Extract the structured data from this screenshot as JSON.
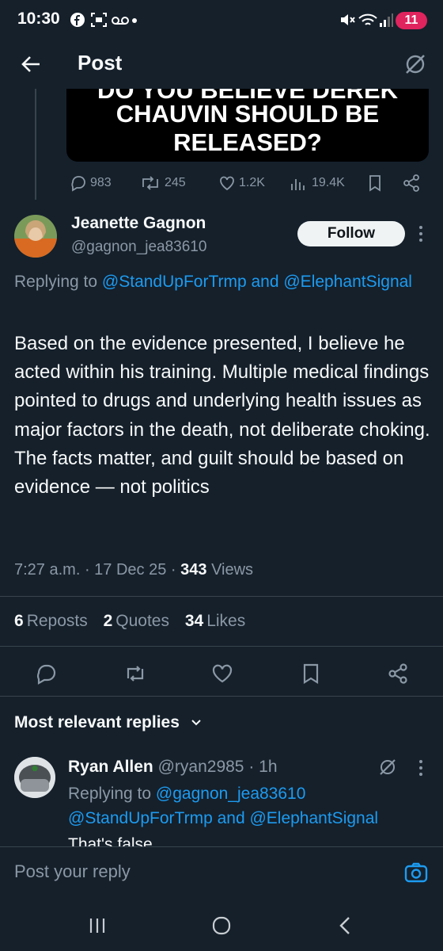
{
  "status_bar": {
    "time": "10:30",
    "battery": "11"
  },
  "header": {
    "title": "Post"
  },
  "quoted_post": {
    "image_lines": [
      "DO YOU BELIEVE DEREK",
      "CHAUVIN SHOULD BE",
      "RELEASED?"
    ]
  },
  "quoted_actions": {
    "replies": "983",
    "reposts": "245",
    "likes": "1.2K",
    "views": "19.4K"
  },
  "post": {
    "author_name": "Jeanette Gagnon",
    "author_handle": "@gagnon_jea83610",
    "follow_label": "Follow",
    "replying_prefix": "Replying to ",
    "replying_to": "@StandUpForTrmp and @ElephantSignal",
    "body": "Based on the evidence presented, I believe he acted within his training. Multiple medical findings pointed to drugs and underlying health issues as major factors in the death, not deliberate choking. The facts matter, and guilt should be based on evidence — not politics",
    "time": "7:27 a.m.",
    "date": "17 Dec 25",
    "views_count": "343",
    "views_label": "Views",
    "reposts_count": "6",
    "reposts_label": "Reposts",
    "quotes_count": "2",
    "quotes_label": "Quotes",
    "likes_count": "34",
    "likes_label": "Likes"
  },
  "replies_section": {
    "title": "Most relevant replies"
  },
  "reply": {
    "author_name": "Ryan Allen",
    "author_handle": "@ryan2985",
    "time": "1h",
    "replying_prefix": "Replying to ",
    "replying_to_1": "@gagnon_jea83610",
    "replying_to_2": "@StandUpForTrmp and @ElephantSignal",
    "text": "That's false"
  },
  "compose": {
    "placeholder": "Post your reply"
  }
}
